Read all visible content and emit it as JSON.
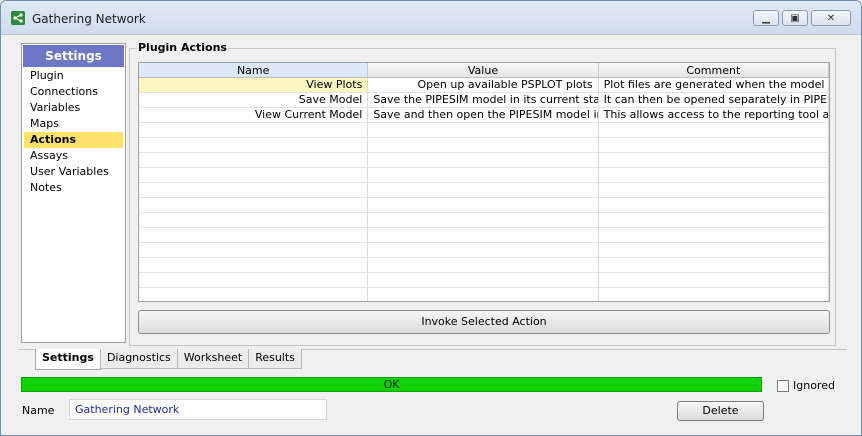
{
  "window": {
    "title": "Gathering Network",
    "icon": "network-share-icon"
  },
  "sidebar": {
    "header": "Settings",
    "items": [
      {
        "label": "Plugin"
      },
      {
        "label": "Connections"
      },
      {
        "label": "Variables"
      },
      {
        "label": "Maps"
      },
      {
        "label": "Actions",
        "active": true
      },
      {
        "label": "Assays"
      },
      {
        "label": "User Variables"
      },
      {
        "label": "Notes"
      }
    ]
  },
  "plugin_actions": {
    "group_label": "Plugin Actions",
    "columns": [
      "Name",
      "Value",
      "Comment"
    ],
    "rows": [
      {
        "name": "View Plots",
        "value": "Open up available PSPLOT plots",
        "comment": "Plot files are generated when the model sc"
      },
      {
        "name": "Save Model",
        "value": "Save the PIPESIM model in its current state",
        "comment": "It can then be opened separately in PIPESII"
      },
      {
        "name": "View Current Model",
        "value": "Save and then open the PIPESIM model in",
        "comment": "This allows access to the reporting tool an"
      }
    ],
    "invoke_label": "Invoke Selected Action"
  },
  "tabs": [
    {
      "label": "Settings",
      "active": true
    },
    {
      "label": "Diagnostics"
    },
    {
      "label": "Worksheet"
    },
    {
      "label": "Results"
    }
  ],
  "status": {
    "text": "OK",
    "color": "#0fd300"
  },
  "ignored": {
    "label": "Ignored",
    "checked": false
  },
  "name_field": {
    "label": "Name",
    "value": "Gathering Network"
  },
  "delete_label": "Delete"
}
